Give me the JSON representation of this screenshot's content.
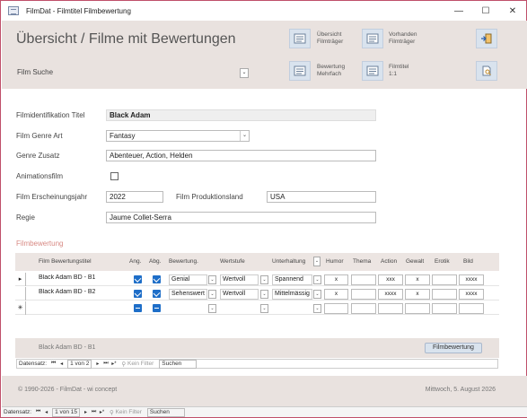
{
  "window": {
    "title": "FilmDat - Filmtitel Filmbewertung",
    "minimize": "—",
    "maximize": "☐",
    "close": "✕"
  },
  "header": {
    "title": "Übersicht / Filme mit Bewertungen",
    "film_search_label": "Film Suche",
    "buttons": [
      {
        "label_line1": "Übersicht",
        "label_line2": "Filmträger",
        "icon": "overview-carrier-icon"
      },
      {
        "label_line1": "Vorhanden",
        "label_line2": "Filmträger",
        "icon": "existing-carrier-icon"
      },
      {
        "label_line1": "",
        "label_line2": "",
        "icon": "exit-icon"
      },
      {
        "label_line1": "Bewertung",
        "label_line2": "Mehrfach",
        "icon": "rating-multiple-icon"
      },
      {
        "label_line1": "Filmtitel",
        "label_line2": "1:1",
        "icon": "filmtitle-icon"
      },
      {
        "label_line1": "",
        "label_line2": "",
        "icon": "document-search-icon"
      }
    ]
  },
  "form": {
    "film_id_label": "Filmidentifikation Titel",
    "film_id_value": "Black Adam",
    "genre_label": "Film Genre Art",
    "genre_value": "Fantasy",
    "genre_extra_label": "Genre Zusatz",
    "genre_extra_value": "Abenteuer, Action, Helden",
    "animation_label": "Animationsfilm",
    "animation_checked": false,
    "year_label": "Film Erscheinungsjahr",
    "year_value": "2022",
    "country_label": "Film Produktionsland",
    "country_value": "USA",
    "director_label": "Regie",
    "director_value": "Jaume Collet-Serra"
  },
  "ratings": {
    "section_title": "Filmbewertung",
    "columns": {
      "title": "Film Bewertungstitel",
      "ang": "Ang.",
      "abg": "Abg.",
      "bewertung": "Bewertung.",
      "wertstufe": "Wertstufe",
      "unterhaltung": "Unterhaltung",
      "humor": "Humor",
      "thema": "Thema",
      "action": "Action",
      "gewalt": "Gewalt",
      "erotik": "Erotik",
      "bild": "Bild"
    },
    "rows": [
      {
        "title": "Black Adam BD - B1",
        "bewertung": "Genial",
        "wertstufe": "Wertvoll",
        "unterhaltung": "Spannend",
        "humor": "x",
        "thema": "",
        "action": "xxx",
        "gewalt": "x",
        "erotik": "",
        "bild": "xxxx"
      },
      {
        "title": "Black Adam BD - B2",
        "bewertung": "Sehenswert",
        "wertstufe": "Wertvoll",
        "unterhaltung": "Mittelmässig",
        "humor": "x",
        "thema": "",
        "action": "xxxx",
        "gewalt": "x",
        "erotik": "",
        "bild": "xxxx"
      }
    ],
    "new_row_marker": "✳",
    "footer_title": "Black Adam BD - B1",
    "footer_button": "Filmbewertung",
    "nav": {
      "label": "Datensatz:",
      "current": "1 von 2",
      "filter": "Kein Filter",
      "search": "Suchen"
    }
  },
  "footer": {
    "copyright": "© 1990-2026 - FilmDat - wi concept",
    "date": "Mittwoch, 5. August 2026"
  },
  "main_nav": {
    "label": "Datensatz:",
    "current": "1 von 15",
    "filter": "Kein Filter",
    "search": "Suchen"
  }
}
